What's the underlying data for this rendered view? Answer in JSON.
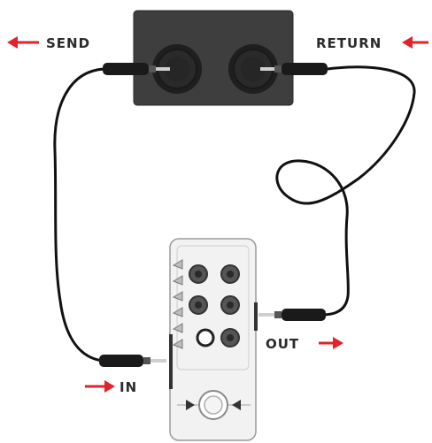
{
  "labels": {
    "send": "SEND",
    "return": "RETURN",
    "in": "IN",
    "out": "OUT"
  },
  "colors": {
    "arrow": "#e2232a",
    "label_text": "#2b2b2b",
    "device_body": "#3e3e3e",
    "cable": "#111111",
    "pedal_body": "#f2f2f2",
    "pedal_outline": "#9a9a9a"
  },
  "icons": {
    "send_arrow": "arrow-left-icon",
    "return_arrow": "arrow-left-icon",
    "in_arrow": "arrow-right-icon",
    "out_arrow": "arrow-right-icon",
    "pedal_footswitch": "footswitch-icon"
  }
}
